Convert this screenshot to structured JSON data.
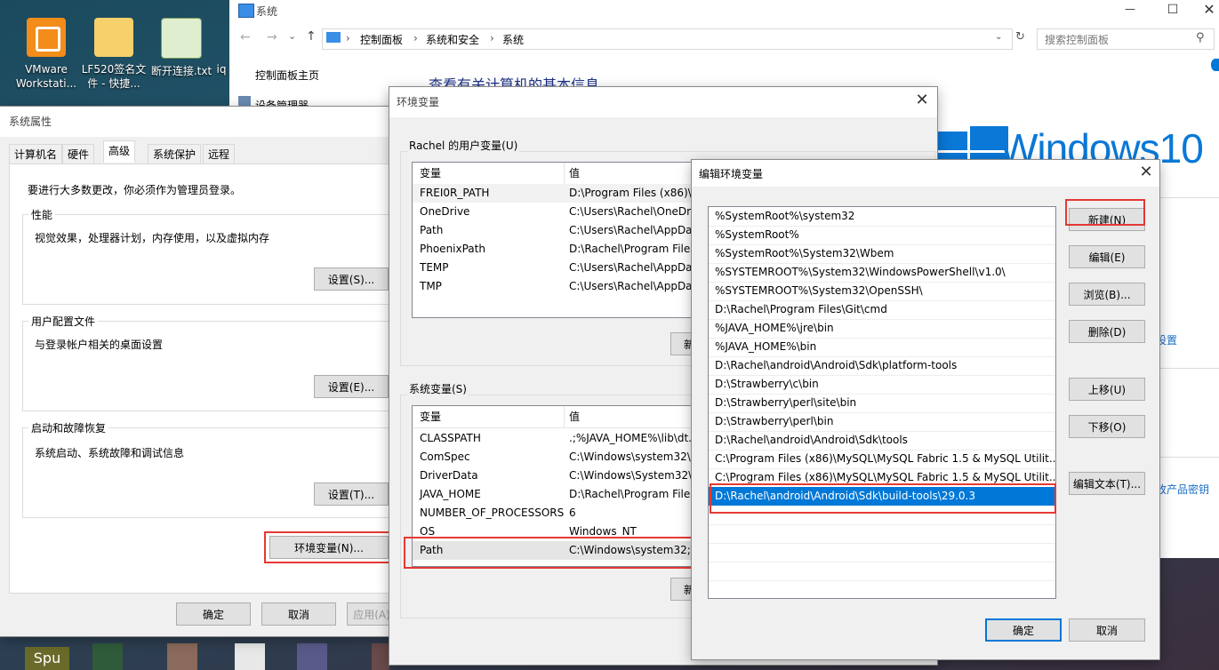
{
  "desktop": {
    "icons": [
      {
        "label": "VMware Workstati..."
      },
      {
        "label": "LF520签名文件 - 快捷..."
      },
      {
        "label": "断开连接.txt"
      },
      {
        "label": "iq"
      }
    ],
    "taskbar_item": "Spu"
  },
  "system_window": {
    "title": "系统",
    "breadcrumb": [
      "控制面板",
      "系统和安全",
      "系统"
    ],
    "search_placeholder": "搜索控制面板",
    "sidebar_home": "控制面板主页",
    "sidebar_device_manager": "设备管理器",
    "heading": "查看有关计算机的基本信息",
    "windows_logo_text": "Windows10",
    "side_link_1": "设置",
    "side_link_2": "改产品密钥"
  },
  "sysprops": {
    "title": "系统属性",
    "tabs": [
      "计算机名",
      "硬件",
      "高级",
      "系统保护",
      "远程"
    ],
    "admin_note": "要进行大多数更改，你必须作为管理员登录。",
    "performance": {
      "label": "性能",
      "desc": "视觉效果，处理器计划，内存使用，以及虚拟内存",
      "button": "设置(S)..."
    },
    "profiles": {
      "label": "用户配置文件",
      "desc": "与登录帐户相关的桌面设置",
      "button": "设置(E)..."
    },
    "startup": {
      "label": "启动和故障恢复",
      "desc": "系统启动、系统故障和调试信息",
      "button": "设置(T)..."
    },
    "env_button": "环境变量(N)...",
    "ok": "确定",
    "cancel": "取消",
    "apply": "应用(A)"
  },
  "envvars": {
    "title": "环境变量",
    "user_group_label": "Rachel 的用户变量(U)",
    "col_var": "变量",
    "col_val": "值",
    "user_vars": [
      {
        "name": "FREI0R_PATH",
        "value": "D:\\Program Files (x86)\\A"
      },
      {
        "name": "OneDrive",
        "value": "C:\\Users\\Rachel\\OneDri"
      },
      {
        "name": "Path",
        "value": "C:\\Users\\Rachel\\AppDat"
      },
      {
        "name": "PhoenixPath",
        "value": "D:\\Rachel\\Program Files"
      },
      {
        "name": "TEMP",
        "value": "C:\\Users\\Rachel\\AppDat"
      },
      {
        "name": "TMP",
        "value": "C:\\Users\\Rachel\\AppDat"
      }
    ],
    "user_new_button": "新",
    "system_group_label": "系统变量(S)",
    "system_vars": [
      {
        "name": "CLASSPATH",
        "value": ".;%JAVA_HOME%\\lib\\dt."
      },
      {
        "name": "ComSpec",
        "value": "C:\\Windows\\system32\\c"
      },
      {
        "name": "DriverData",
        "value": "C:\\Windows\\System32\\D"
      },
      {
        "name": "JAVA_HOME",
        "value": "D:\\Rachel\\Program Files"
      },
      {
        "name": "NUMBER_OF_PROCESSORS",
        "value": "6"
      },
      {
        "name": "OS",
        "value": "Windows_NT"
      },
      {
        "name": "Path",
        "value": "C:\\Windows\\system32;C"
      }
    ],
    "system_new_button": "新"
  },
  "editenv": {
    "title": "编辑环境变量",
    "entries": [
      "%SystemRoot%\\system32",
      "%SystemRoot%",
      "%SystemRoot%\\System32\\Wbem",
      "%SYSTEMROOT%\\System32\\WindowsPowerShell\\v1.0\\",
      "%SYSTEMROOT%\\System32\\OpenSSH\\",
      "D:\\Rachel\\Program Files\\Git\\cmd",
      "%JAVA_HOME%\\jre\\bin",
      "%JAVA_HOME%\\bin",
      "D:\\Rachel\\android\\Android\\Sdk\\platform-tools",
      "D:\\Strawberry\\c\\bin",
      "D:\\Strawberry\\perl\\site\\bin",
      "D:\\Strawberry\\perl\\bin",
      "D:\\Rachel\\android\\Android\\Sdk\\tools",
      "C:\\Program Files (x86)\\MySQL\\MySQL Fabric 1.5 & MySQL Utilit...",
      "C:\\Program Files (x86)\\MySQL\\MySQL Fabric 1.5 & MySQL Utilit...",
      "D:\\Rachel\\android\\Android\\Sdk\\build-tools\\29.0.3"
    ],
    "selected_index": 15,
    "buttons": {
      "new": "新建(N)",
      "edit": "编辑(E)",
      "browse": "浏览(B)...",
      "delete": "删除(D)",
      "up": "上移(U)",
      "down": "下移(O)",
      "edit_text": "编辑文本(T)..."
    },
    "ok": "确定",
    "cancel": "取消"
  }
}
